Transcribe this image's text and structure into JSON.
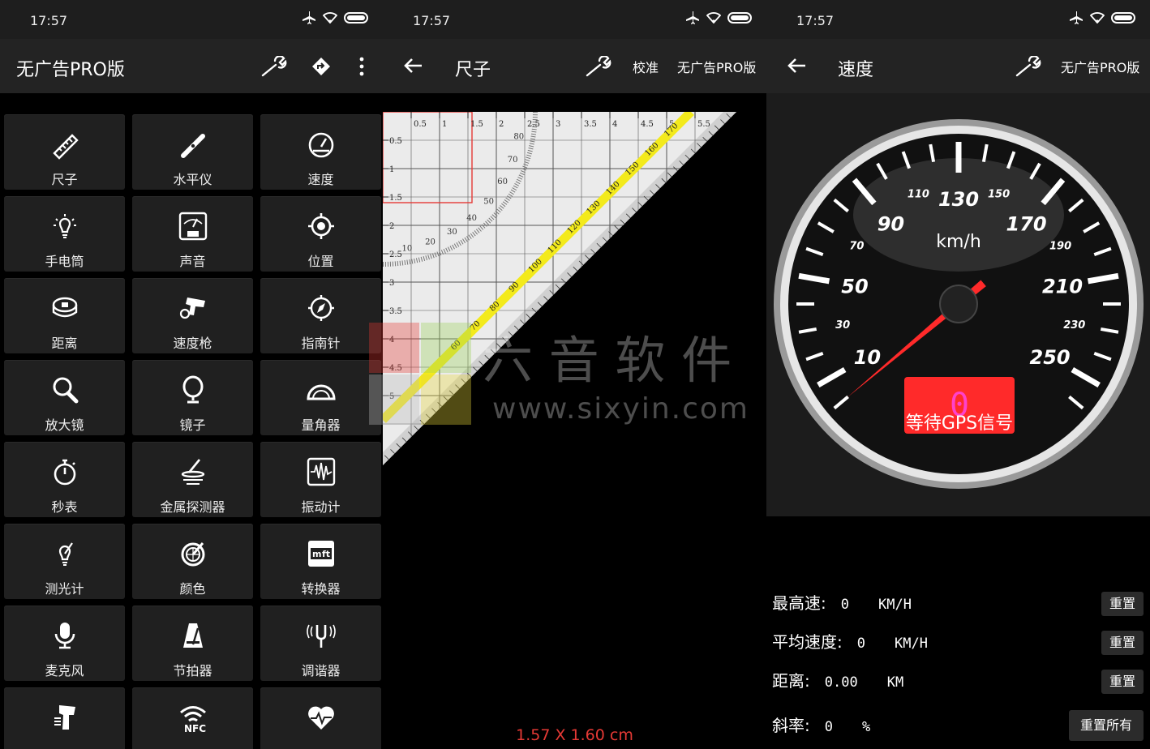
{
  "status": {
    "time": "17:57"
  },
  "home": {
    "title": "无广告PRO版",
    "grid": [
      {
        "label": "尺子",
        "icon": "ruler-icon"
      },
      {
        "label": "水平仪",
        "icon": "level-icon"
      },
      {
        "label": "速度",
        "icon": "speedometer-icon"
      },
      {
        "label": "手电筒",
        "icon": "flashlight-icon"
      },
      {
        "label": "声音",
        "icon": "sound-meter-icon"
      },
      {
        "label": "位置",
        "icon": "location-icon"
      },
      {
        "label": "距离",
        "icon": "tape-measure-icon"
      },
      {
        "label": "速度枪",
        "icon": "speed-gun-icon"
      },
      {
        "label": "指南针",
        "icon": "compass-icon"
      },
      {
        "label": "放大镜",
        "icon": "magnifier-icon"
      },
      {
        "label": "镜子",
        "icon": "mirror-icon"
      },
      {
        "label": "量角器",
        "icon": "protractor-icon"
      },
      {
        "label": "秒表",
        "icon": "stopwatch-icon"
      },
      {
        "label": "金属探测器",
        "icon": "metal-detector-icon"
      },
      {
        "label": "振动计",
        "icon": "vibrometer-icon"
      },
      {
        "label": "测光计",
        "icon": "light-meter-icon"
      },
      {
        "label": "颜色",
        "icon": "color-picker-icon"
      },
      {
        "label": "转换器",
        "icon": "converter-icon"
      },
      {
        "label": "麦克风",
        "icon": "microphone-icon"
      },
      {
        "label": "节拍器",
        "icon": "metronome-icon"
      },
      {
        "label": "调谐器",
        "icon": "tuning-fork-icon"
      },
      {
        "label": "",
        "icon": "barcode-scanner-icon"
      },
      {
        "label": "",
        "icon": "nfc-icon"
      },
      {
        "label": "",
        "icon": "heart-rate-icon"
      }
    ]
  },
  "ruler": {
    "title": "尺子",
    "calibrate": "校准",
    "pro": "无广告PRO版",
    "measurement": "1.57 X 1.60 cm",
    "top_ticks": [
      "0.5",
      "1",
      "1.5",
      "2",
      "2.5",
      "3",
      "3.5",
      "4",
      "4.5",
      "5",
      "5.5"
    ],
    "left_ticks": [
      "0.5",
      "1",
      "1.5",
      "2",
      "2.5",
      "3",
      "3.5",
      "4",
      "4.5",
      "5"
    ],
    "angle_ticks": [
      "10",
      "20",
      "30",
      "40",
      "50",
      "60",
      "70",
      "80"
    ],
    "diag_ticks": [
      "60",
      "70",
      "80",
      "90",
      "100",
      "110",
      "120",
      "130",
      "140",
      "150",
      "160",
      "170"
    ]
  },
  "speed": {
    "title": "速度",
    "pro": "无广告PRO版",
    "unit": "km/h",
    "gps_status": "等待GPS信号",
    "digit": "0",
    "dial_major": [
      "10",
      "50",
      "90",
      "130",
      "170",
      "210",
      "250"
    ],
    "dial_minor": [
      "30",
      "70",
      "110",
      "150",
      "190",
      "230"
    ],
    "needle_value": 0,
    "rows": [
      {
        "label": "最高速:",
        "value": "0",
        "unit": "KM/H",
        "btn": "重置"
      },
      {
        "label": "平均速度:",
        "value": "0",
        "unit": "KM/H",
        "btn": "重置"
      },
      {
        "label": "距离:",
        "value": "0.00",
        "unit": "KM",
        "btn": "重置"
      },
      {
        "label": "斜率:",
        "value": "0",
        "unit": "%",
        "btn": "重置所有"
      }
    ]
  },
  "watermark": {
    "cn": "六 音 软 件",
    "url": "www.sixyin.com"
  },
  "colors": {
    "accent_red": "#e53935",
    "gauge_red": "#ff2a2a",
    "ruler_yellow": "#f3ea1c"
  }
}
